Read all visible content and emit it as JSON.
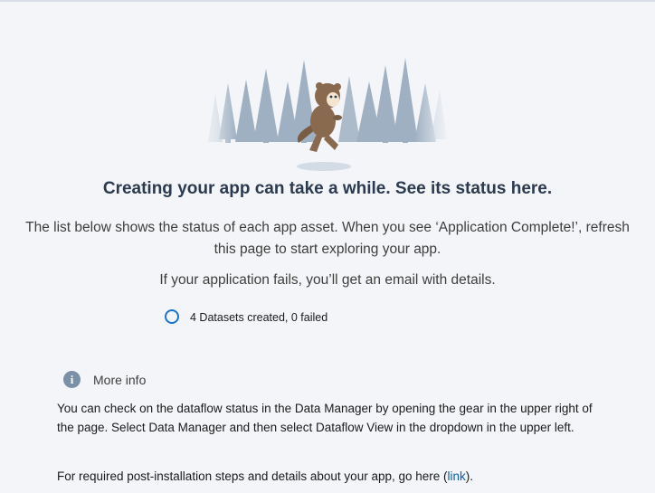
{
  "illustration": {
    "alt": "character-running-through-trees",
    "colors": {
      "trees": "#9fb0c2",
      "character": "#8a6a4f",
      "shadow": "#d3dbe5"
    }
  },
  "headline": "Creating your app can take a while. See its status here.",
  "description": "The list below shows the status of each app asset. When you see ‘Application Complete!’, refresh this page to start exploring your app.",
  "fail_note": "If your application fails, you’ll get an email with details.",
  "status": {
    "text": "4 Datasets created, 0 failed",
    "ring_color": "#1b74c9"
  },
  "more_info": {
    "icon": "info-icon",
    "icon_glyph": "i",
    "title": "More info",
    "body": "You can check on the dataflow status in the Data Manager by opening the gear in the upper right of the page. Select Data Manager and then select Dataflow View in the dropdown in the upper left.",
    "links_prefix": "For required post-installation steps and details about your app, go here (",
    "link_label": "link",
    "links_suffix": ")."
  }
}
